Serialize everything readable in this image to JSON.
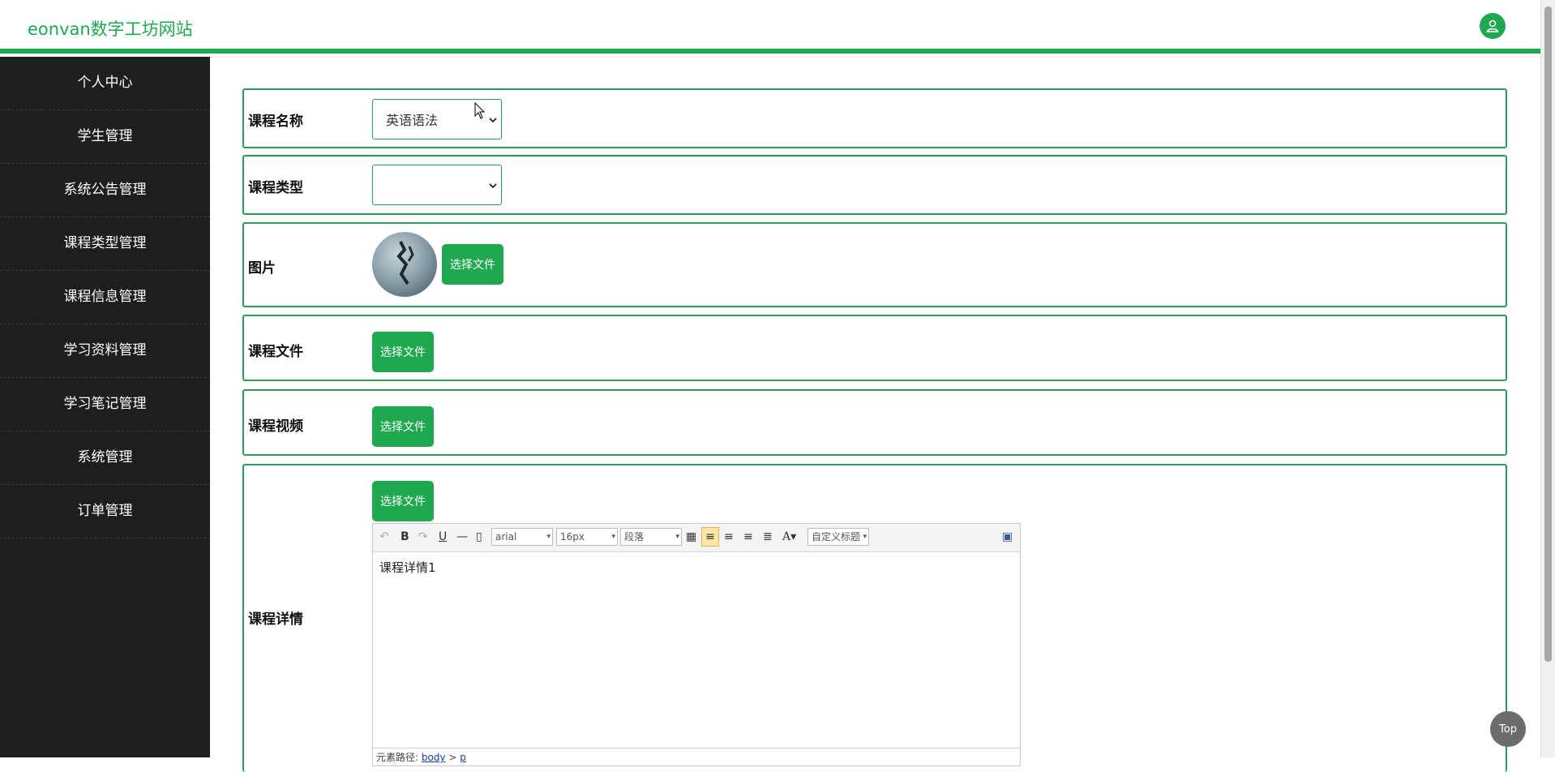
{
  "header": {
    "brand": "eonvan数字工坊网站",
    "user_icon": "user-icon"
  },
  "sidebar": {
    "items": [
      {
        "label": "个人中心"
      },
      {
        "label": "学生管理"
      },
      {
        "label": "系统公告管理"
      },
      {
        "label": "课程类型管理"
      },
      {
        "label": "课程信息管理"
      },
      {
        "label": "学习资料管理"
      },
      {
        "label": "学习笔记管理"
      },
      {
        "label": "系统管理"
      },
      {
        "label": "订单管理"
      }
    ]
  },
  "form": {
    "course_name": {
      "label": "课程名称",
      "value": "英语语法"
    },
    "course_type": {
      "label": "课程类型",
      "value": ""
    },
    "image": {
      "label": "图片",
      "button": "选择文件"
    },
    "course_file": {
      "label": "课程文件",
      "button": "选择文件"
    },
    "course_video": {
      "label": "课程视频",
      "button": "选择文件"
    },
    "course_detail": {
      "label": "课程详情",
      "button": "选择文件",
      "editor": {
        "font_family": "arial",
        "font_size": "16px",
        "paragraph": "段落",
        "custom_title": "自定义标题",
        "content": "课程详情1",
        "path_label": "元素路径:",
        "path_body": "body",
        "path_sep": ">",
        "path_p": "p"
      }
    }
  },
  "top_button": "Top",
  "colors": {
    "accent": "#1fa84f",
    "sidebar_bg": "#1e1e1e",
    "border": "#2e9a5e"
  }
}
